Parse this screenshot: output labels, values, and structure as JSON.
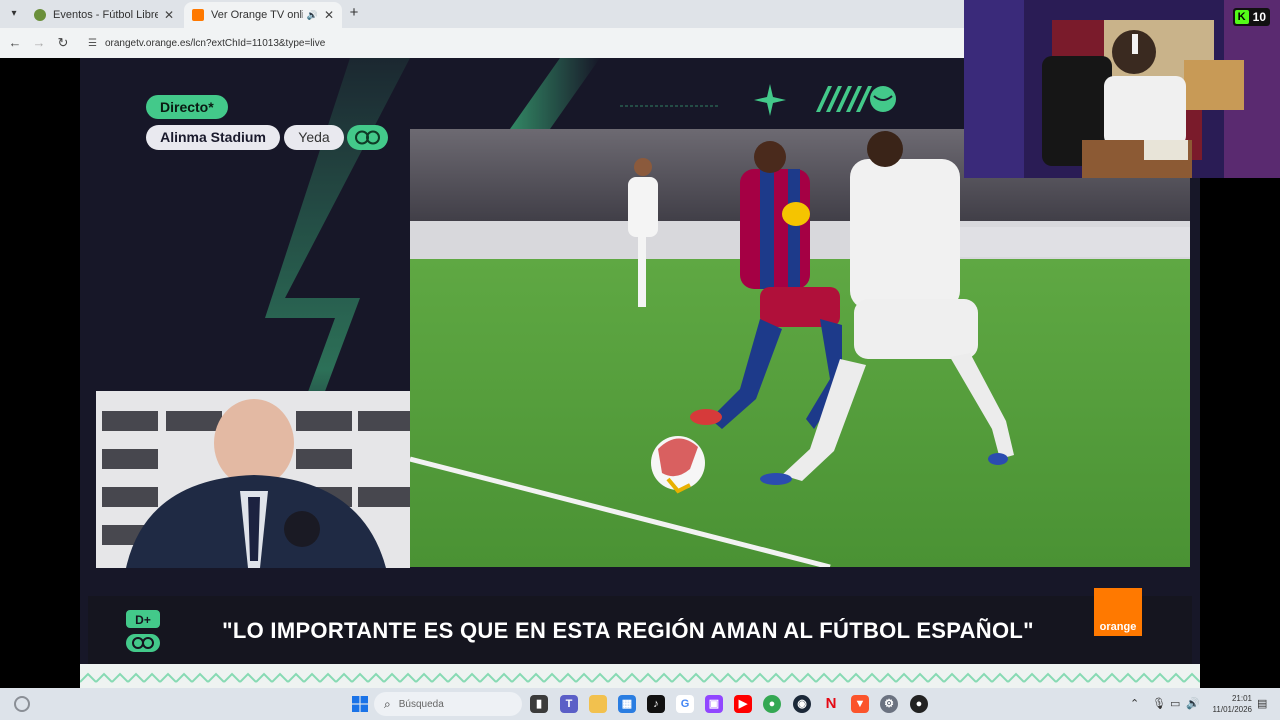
{
  "browser": {
    "tabs": [
      {
        "title": "Eventos - Fútbol Libre TV",
        "active": false
      },
      {
        "title": "Ver Orange TV online en tu",
        "active": true
      }
    ],
    "url": "orangetv.orange.es/lcn?extChId=11013&type=live"
  },
  "broadcast": {
    "live_label": "Directo*",
    "stadium": "Alinma Stadium",
    "city": "Yeda",
    "headline": "\"LO IMPORTANTE ES QUE EN ESTA REGIÓN AMAN AL FÚTBOL ESPAÑOL\"",
    "brand_logo_text": "orange",
    "colors": {
      "accent": "#43c98a",
      "background": "#1a1a2c",
      "brand": "#ff7900"
    }
  },
  "webcam": {
    "platform_icon": "kick-icon",
    "viewer_count": "10"
  },
  "taskbar": {
    "search_placeholder": "Búsqueda",
    "time": "21:01",
    "date": "11/01/2026",
    "apps": [
      "task-view-icon",
      "teams-icon",
      "file-explorer-icon",
      "store-icon",
      "tiktok-icon",
      "google-icon",
      "twitch-icon",
      "youtube-icon",
      "chrome-icon",
      "steam-icon",
      "netflix-icon",
      "brave-icon",
      "settings-icon",
      "app-icon"
    ]
  }
}
